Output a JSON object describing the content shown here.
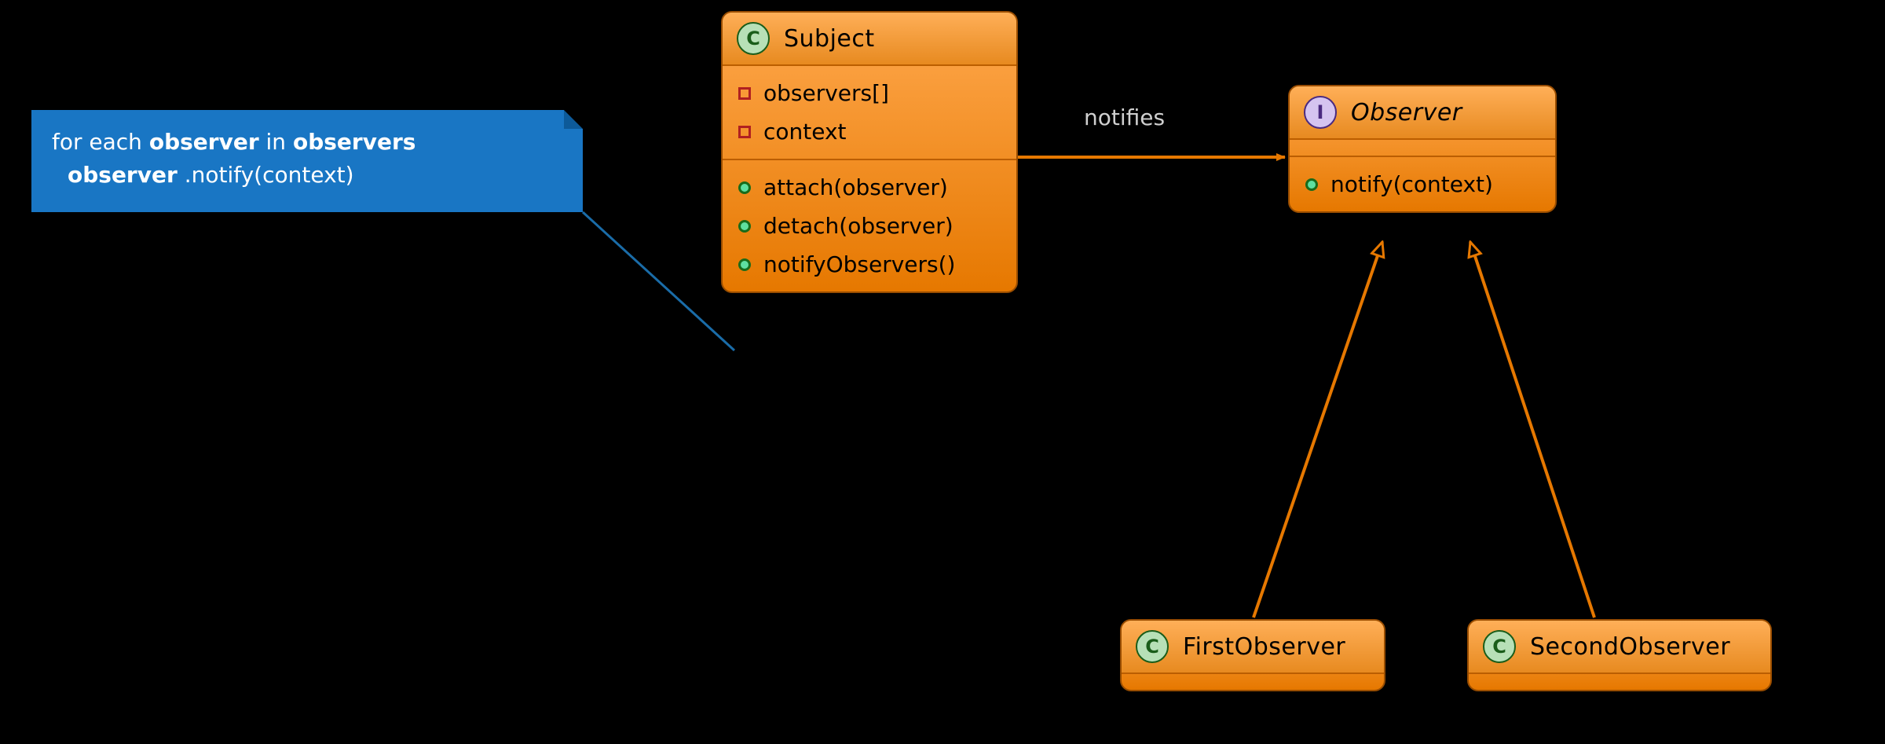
{
  "colors": {
    "box_orange_top": "#ffa84d",
    "box_orange_bottom": "#e67800",
    "line_orange": "#e67800",
    "note_blue": "#1976c4",
    "badge_class": "#b7e0b7",
    "badge_interface": "#d5c4f0"
  },
  "note": {
    "line1_a": "for each ",
    "line1_b": "observer",
    "line1_c": "  in ",
    "line1_d": "observers",
    "line2_a": "observer",
    "line2_b": " .notify(context)"
  },
  "subject": {
    "badge": "C",
    "title": "Subject",
    "fields": [
      "observers[]",
      "context"
    ],
    "methods": [
      "attach(observer)",
      "detach(observer)",
      "notifyObservers()"
    ]
  },
  "observer": {
    "badge": "I",
    "title": "Observer",
    "methods": [
      "notify(context)"
    ]
  },
  "first_observer": {
    "badge": "C",
    "title": "FirstObserver"
  },
  "second_observer": {
    "badge": "C",
    "title": "SecondObserver"
  },
  "edges": {
    "subject_to_observer": "notifies"
  }
}
